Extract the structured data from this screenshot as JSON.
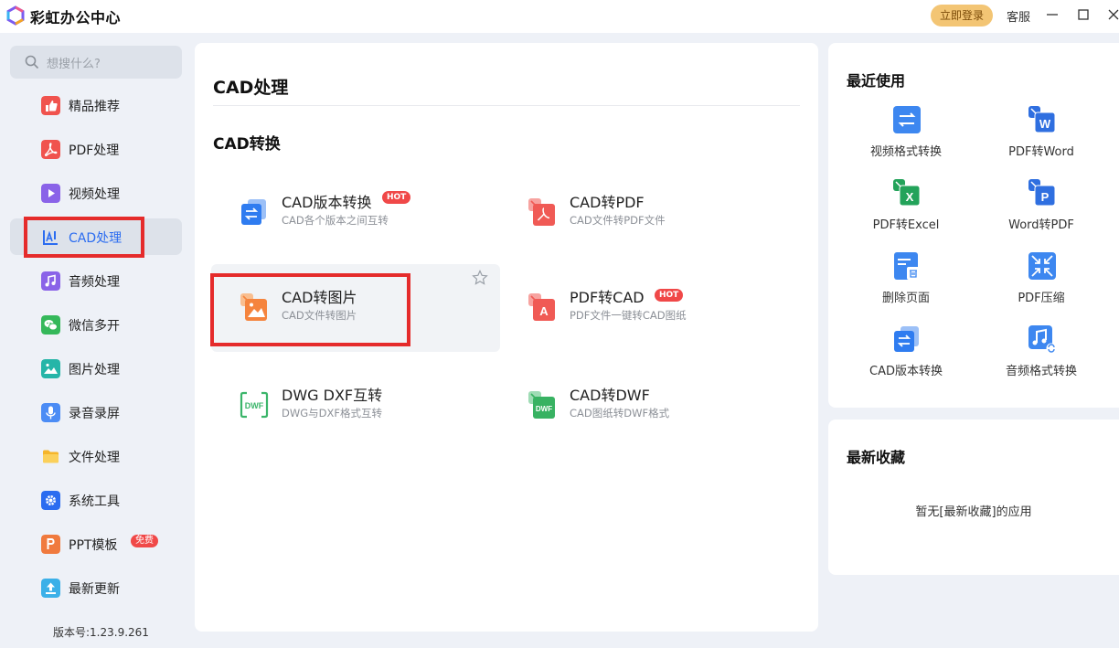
{
  "titlebar": {
    "app_title": "彩虹办公中心",
    "login_label": "立即登录",
    "service_label": "客服"
  },
  "sidebar": {
    "search_placeholder": "想搜什么?",
    "items": [
      {
        "label": "精品推荐",
        "icon": "thumbs-up-icon",
        "color": "#f0534e"
      },
      {
        "label": "PDF处理",
        "icon": "pdf-icon",
        "color": "#f0534e"
      },
      {
        "label": "视频处理",
        "icon": "video-play-icon",
        "color": "#8a63e8"
      },
      {
        "label": "CAD处理",
        "icon": "cad-icon",
        "color": "#2b6cf0"
      },
      {
        "label": "音频处理",
        "icon": "music-note-icon",
        "color": "#8a63e8"
      },
      {
        "label": "微信多开",
        "icon": "wechat-icon",
        "color": "#35b85a"
      },
      {
        "label": "图片处理",
        "icon": "image-icon",
        "color": "#26b5a8"
      },
      {
        "label": "录音录屏",
        "icon": "microphone-icon",
        "color": "#4b8cf5"
      },
      {
        "label": "文件处理",
        "icon": "folder-icon",
        "color": "#f5b52a"
      },
      {
        "label": "系统工具",
        "icon": "gear-icon",
        "color": "#2b6cf0"
      },
      {
        "label": "PPT模板",
        "icon": "ppt-icon",
        "color": "#f07a3e",
        "badge": "免费"
      },
      {
        "label": "最新更新",
        "icon": "upload-arrow-icon",
        "color": "#3bb0e8"
      }
    ],
    "active_index": 3,
    "version": "版本号:1.23.9.261"
  },
  "main": {
    "title": "CAD处理",
    "section_title": "CAD转换",
    "tools": [
      {
        "name": "CAD版本转换",
        "desc": "CAD各个版本之间互转",
        "icon": "cad-version-convert-icon",
        "hot": "HOT"
      },
      {
        "name": "CAD转PDF",
        "desc": "CAD文件转PDF文件",
        "icon": "cad-to-pdf-icon"
      },
      {
        "name": "CAD转图片",
        "desc": "CAD文件转图片",
        "icon": "cad-to-image-icon"
      },
      {
        "name": "PDF转CAD",
        "desc": "PDF文件一键转CAD图纸",
        "icon": "pdf-to-cad-icon",
        "hot": "HOT"
      },
      {
        "name": "DWG DXF互转",
        "desc": "DWG与DXF格式互转",
        "icon": "dwg-dxf-convert-icon"
      },
      {
        "name": "CAD转DWF",
        "desc": "CAD图纸转DWF格式",
        "icon": "cad-to-dwf-icon"
      }
    ],
    "icon_text": {
      "dwf": "DWF",
      "pdf_a": "A"
    }
  },
  "recent": {
    "title": "最近使用",
    "items": [
      {
        "label": "视频格式转换",
        "icon": "video-format-convert-icon"
      },
      {
        "label": "PDF转Word",
        "icon": "pdf-to-word-icon"
      },
      {
        "label": "PDF转Excel",
        "icon": "pdf-to-excel-icon"
      },
      {
        "label": "Word转PDF",
        "icon": "word-to-pdf-icon"
      },
      {
        "label": "删除页面",
        "icon": "delete-page-icon"
      },
      {
        "label": "PDF压缩",
        "icon": "pdf-compress-icon"
      },
      {
        "label": "CAD版本转换",
        "icon": "cad-version-convert-icon"
      },
      {
        "label": "音频格式转换",
        "icon": "audio-format-convert-icon"
      }
    ],
    "letters": {
      "word": "W",
      "excel": "X",
      "pdf": "P"
    }
  },
  "favorites": {
    "title": "最新收藏",
    "empty_text": "暂无[最新收藏]的应用"
  }
}
